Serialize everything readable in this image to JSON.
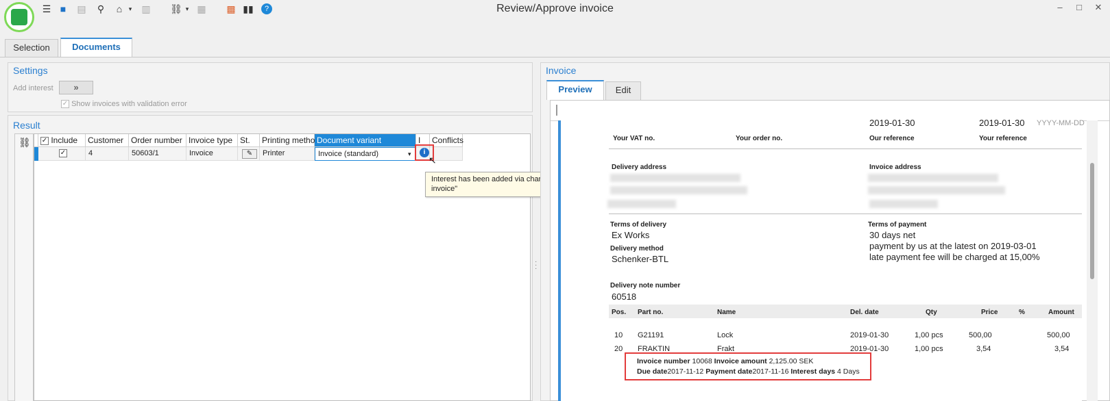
{
  "window": {
    "title": "Review/Approve invoice",
    "min": "–",
    "max": "□",
    "close": "✕"
  },
  "toolbar": {
    "icons": [
      "list-icon",
      "save-icon",
      "print-icon",
      "search-icon",
      "home-icon",
      "document-icon",
      "link-icon",
      "table-icon",
      "color-grid-icon",
      "books-icon",
      "help-icon"
    ]
  },
  "tabs": [
    {
      "label": "Selection"
    },
    {
      "label": "Documents"
    }
  ],
  "settings": {
    "title": "Settings",
    "add_interest_label": "Add interest",
    "add_interest_button": "»",
    "show_invalid_label": "Show invoices with validation error"
  },
  "result": {
    "title": "Result",
    "columns": [
      "Include",
      "Customer",
      "Order number",
      "Invoice type",
      "St.",
      "Printing method",
      "Document variant",
      "I",
      "Conflicts"
    ],
    "rows": [
      {
        "include": "✓",
        "customer": "4",
        "order_number": "50603/1",
        "invoice_type": "Invoice",
        "printing_method": "Printer",
        "document_variant": "Invoice (standard)"
      }
    ],
    "tooltip": "Interest has been added via charge of the type \"Next regular invoice\""
  },
  "invoice_panel": {
    "title": "Invoice",
    "tabs": [
      {
        "label": "Preview"
      },
      {
        "label": "Edit"
      }
    ],
    "doc": {
      "date1": "2019-01-30",
      "date2": "2019-01-30",
      "date_format": "YYYY-MM-DD",
      "your_vat_label": "Your VAT no.",
      "your_order_label": "Your order no.",
      "our_ref_label": "Our reference",
      "your_ref_label": "Your reference",
      "delivery_address_label": "Delivery address",
      "invoice_address_label": "Invoice address",
      "terms_delivery_label": "Terms of delivery",
      "terms_delivery": "Ex Works",
      "delivery_method_label": "Delivery method",
      "delivery_method": "Schenker-BTL",
      "terms_payment_label": "Terms of payment",
      "terms_payment_1": "30 days net",
      "terms_payment_2": "payment by us at the latest on 2019-03-01",
      "terms_payment_3": "late payment fee will be charged at 15,00%",
      "delivery_note_label": "Delivery note number",
      "delivery_note": "60518",
      "table_headers": [
        "Pos.",
        "Part no.",
        "Name",
        "Del. date",
        "Qty",
        "Price",
        "%",
        "Amount"
      ],
      "lines": [
        {
          "pos": "10",
          "part": "G21191",
          "name": "Lock",
          "date": "2019-01-30",
          "qty": "1,00 pcs",
          "price": "500,00",
          "amount": "500,00"
        },
        {
          "pos": "20",
          "part": "FRAKTIN",
          "name": "Frakt",
          "date": "2019-01-30",
          "qty": "1,00 pcs",
          "price": "3,54",
          "amount": "3,54"
        }
      ],
      "interest": {
        "invoice_number_label": "Invoice number",
        "invoice_number": "10068",
        "invoice_amount_label": "Invoice amount",
        "invoice_amount": "2,125.00 SEK",
        "due_date_label": "Due date",
        "due_date": "2017-11-12",
        "payment_date_label": "Payment date",
        "payment_date": "2017-11-16",
        "interest_days_label": "Interest days",
        "interest_days": "4 Days"
      }
    }
  },
  "colors": {
    "accent": "#2a7fd0",
    "highlight": "#e23b3b",
    "logo": "#2aa84a"
  }
}
